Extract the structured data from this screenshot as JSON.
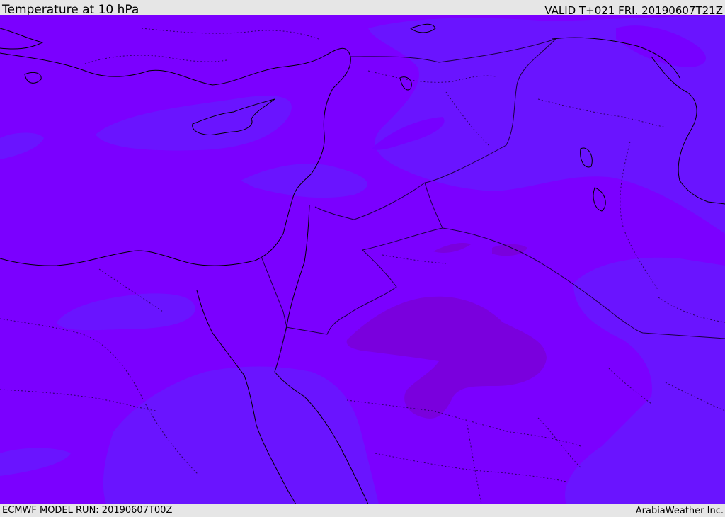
{
  "header": {
    "title": "Temperature at 10 hPa",
    "valid": "VALID T+021 FRI. 20190607T21Z"
  },
  "footer": {
    "model_run": "ECMWF MODEL RUN: 20190607T00Z",
    "credit": "ArabiaWeather Inc."
  },
  "map": {
    "colors": {
      "base": "#7b00ff",
      "cooler": "#6a14ff",
      "warmer": "#7a00e0",
      "coast": "#000000",
      "border": "#1a0040"
    }
  }
}
